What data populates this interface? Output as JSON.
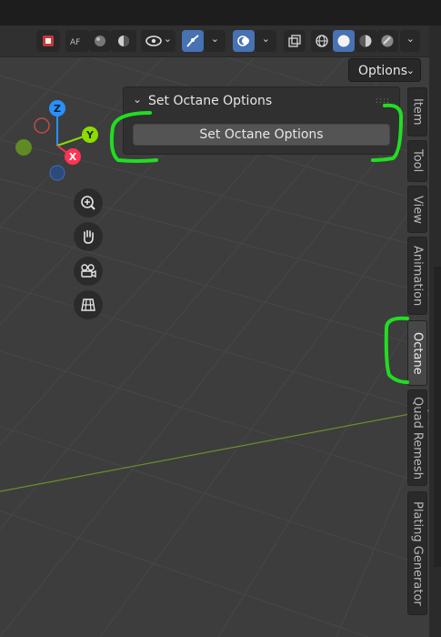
{
  "header": {
    "options_label": "Options"
  },
  "panel": {
    "title": "Set Octane Options",
    "button_label": "Set Octane Options"
  },
  "gizmo": {
    "z": "Z",
    "y": "Y",
    "x": "X"
  },
  "sidebar_tabs": [
    {
      "label": "Item"
    },
    {
      "label": "Tool"
    },
    {
      "label": "View"
    },
    {
      "label": "Animation"
    },
    {
      "label": "Octane"
    },
    {
      "label": "Quad Remesh"
    },
    {
      "label": "Plating Generator"
    }
  ],
  "active_tab": "Octane",
  "colors": {
    "annotation": "#22dd22",
    "axis_x": "#ff3352",
    "axis_y": "#8bdc00",
    "axis_z": "#2890ff",
    "active_button": "#4772b3"
  }
}
